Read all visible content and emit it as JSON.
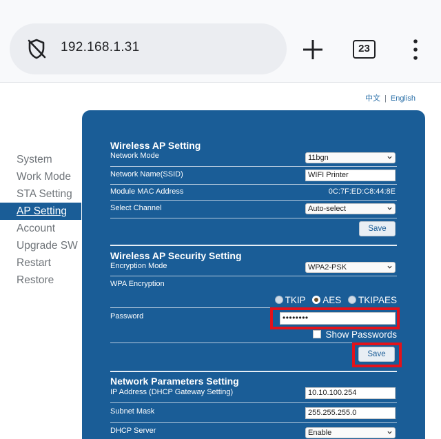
{
  "browser": {
    "url": "192.168.1.31",
    "tab_count": "23"
  },
  "language": {
    "chinese": "中文",
    "separator": "|",
    "english": "English"
  },
  "sidebar": {
    "items": [
      {
        "label": "System"
      },
      {
        "label": "Work Mode"
      },
      {
        "label": "STA Setting"
      },
      {
        "label": "AP Setting",
        "active": true
      },
      {
        "label": "Account"
      },
      {
        "label": "Upgrade SW"
      },
      {
        "label": "Restart"
      },
      {
        "label": "Restore"
      }
    ]
  },
  "ap_setting": {
    "title": "Wireless AP Setting",
    "network_mode_label": "Network Mode",
    "network_mode_value": "11bgn",
    "ssid_label": "Network Name(SSID)",
    "ssid_value": "WIFI Printer",
    "mac_label": "Module MAC Address",
    "mac_value": "0C:7F:ED:C8:44:8E",
    "channel_label": "Select Channel",
    "channel_value": "Auto-select",
    "save_label": "Save"
  },
  "security": {
    "title": "Wireless AP Security Setting",
    "encryption_mode_label": "Encryption Mode",
    "encryption_mode_value": "WPA2-PSK",
    "wpa_label": "WPA Encryption",
    "options": [
      {
        "label": "TKIP",
        "checked": false
      },
      {
        "label": "AES",
        "checked": true
      },
      {
        "label": "TKIPAES",
        "checked": false
      }
    ],
    "password_label": "Password",
    "password_value": "••••••••",
    "show_passwords_label": "Show Passwords",
    "save_label": "Save"
  },
  "network": {
    "title": "Network Parameters Setting",
    "ip_label": "IP Address (DHCP Gateway Setting)",
    "ip_value": "10.10.100.254",
    "subnet_label": "Subnet Mask",
    "subnet_value": "255.255.255.0",
    "dhcp_label": "DHCP Server",
    "dhcp_value": "Enable"
  },
  "colors": {
    "panel": "#1a5d97",
    "highlight": "#e4121a",
    "link": "#2a6fa8"
  }
}
